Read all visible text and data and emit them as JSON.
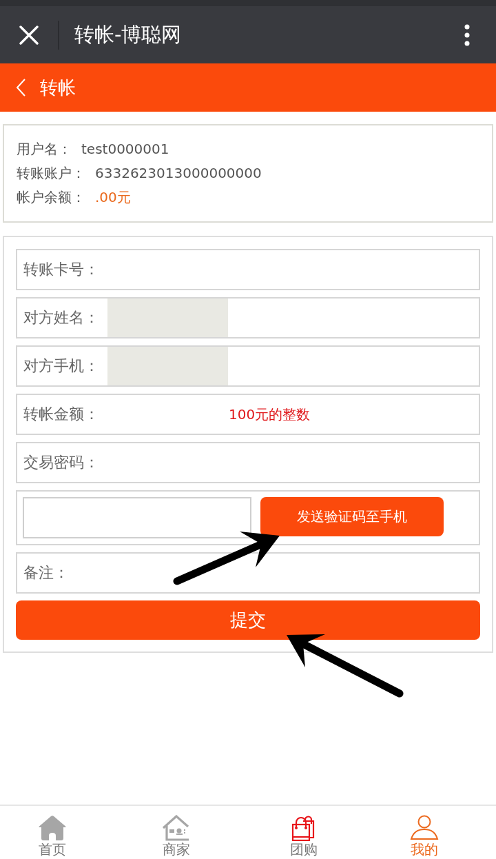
{
  "app_bar": {
    "title": "转帐-博聪网"
  },
  "header": {
    "title": "转帐"
  },
  "account": [
    {
      "kind": "text",
      "label": "用户名：",
      "value": "test0000001"
    },
    {
      "kind": "text",
      "label": "转账账户：",
      "value": "6332623013000000000"
    },
    {
      "kind": "money",
      "label": "帐户余额：",
      "value": ".00元"
    }
  ],
  "form": {
    "fields": [
      {
        "kind": "input",
        "label": "转账卡号：",
        "readonly": false
      },
      {
        "kind": "input",
        "label": "对方姓名：",
        "readonly": true
      },
      {
        "kind": "input",
        "label": "对方手机：",
        "readonly": true
      },
      {
        "kind": "input",
        "label": "转帐金额：",
        "readonly": false,
        "hint": "100元的整数"
      },
      {
        "kind": "input",
        "label": "交易密码：",
        "readonly": false
      },
      {
        "kind": "code",
        "button": "发送验证码至手机"
      },
      {
        "kind": "input",
        "label": "备注：",
        "readonly": false
      }
    ],
    "submit": "提交"
  },
  "bottom_nav": [
    {
      "label": "首页",
      "selected": false,
      "color": "#a6a6a6"
    },
    {
      "label": "商家",
      "selected": false,
      "color": "#a6a6a6"
    },
    {
      "label": "团购",
      "selected": false,
      "color": "#e8141a"
    },
    {
      "label": "我的",
      "selected": true,
      "color": "#ec6a1f"
    }
  ]
}
